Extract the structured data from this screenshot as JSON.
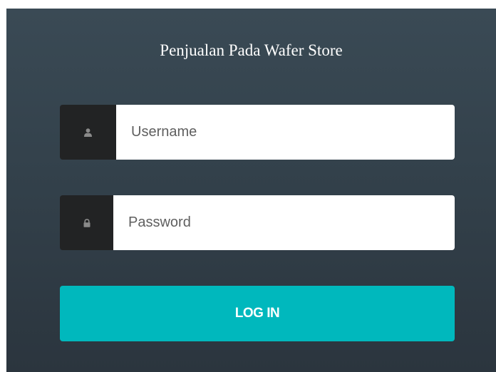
{
  "form": {
    "title": "Penjualan Pada Wafer Store",
    "username": {
      "placeholder": "Username",
      "value": "",
      "icon": "user-icon"
    },
    "password": {
      "placeholder": "Password",
      "value": "",
      "icon": "lock-icon"
    },
    "login_label": "LOG IN"
  },
  "colors": {
    "panel_top": "#3a4a55",
    "panel_bottom": "#2b353e",
    "addon_bg": "#222324",
    "input_bg": "#ffffff",
    "button_bg": "#00b8bd",
    "button_text": "#ffffff"
  }
}
